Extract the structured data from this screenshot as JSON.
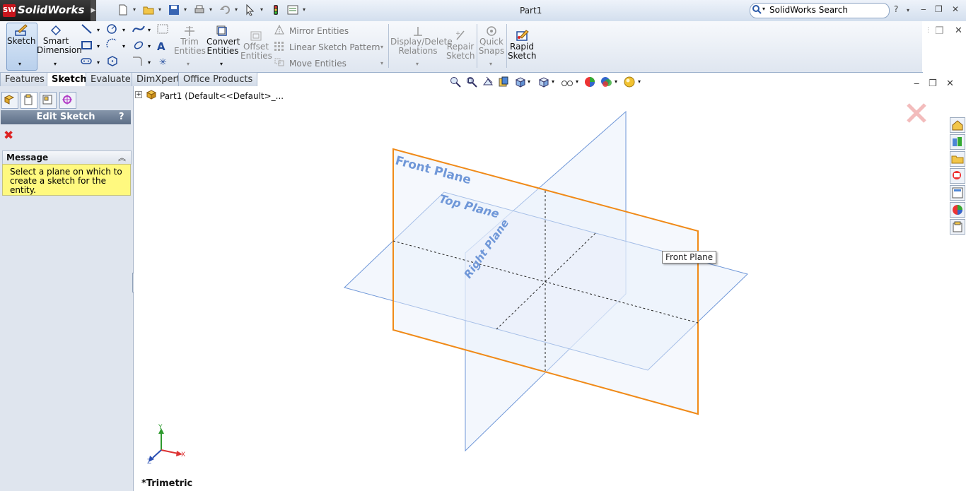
{
  "app": {
    "logo_badge": "SW",
    "logo_text": "SolidWorks",
    "document_title": "Part1",
    "search_placeholder": "SolidWorks Search",
    "help_label": "?"
  },
  "commands": {
    "sketch": "Sketch",
    "smart_dimension_1": "Smart",
    "smart_dimension_2": "Dimension",
    "trim_1": "Trim",
    "trim_2": "Entities",
    "convert_1": "Convert",
    "convert_2": "Entities",
    "offset_1": "Offset",
    "offset_2": "Entities",
    "mirror": "Mirror Entities",
    "linear_pattern": "Linear Sketch Pattern",
    "move": "Move Entities",
    "display_delete_1": "Display/Delete",
    "display_delete_2": "Relations",
    "repair_1": "Repair",
    "repair_2": "Sketch",
    "quick_1": "Quick",
    "quick_2": "Snaps",
    "rapid_1": "Rapid",
    "rapid_2": "Sketch"
  },
  "tabs": [
    {
      "label": "Features"
    },
    {
      "label": "Sketch"
    },
    {
      "label": "Evaluate"
    },
    {
      "label": "DimXpert"
    },
    {
      "label": "Office Products"
    }
  ],
  "property_manager": {
    "title": "Edit Sketch",
    "help": "?",
    "message_header": "Message",
    "message_line1": "Select a plane on which to",
    "message_line2": "create a sketch for the entity."
  },
  "feature_tree": {
    "root_label": "Part1  (Default<<Default>_..."
  },
  "viewport": {
    "front_plane_label": "Front Plane",
    "top_plane_label": "Top Plane",
    "right_plane_label": "Right Plane",
    "tooltip": "Front Plane",
    "view_name": "*Trimetric",
    "triad_x": "X",
    "triad_y": "Y",
    "triad_z": "Z"
  },
  "colors": {
    "plane_blue": "#6f97d8",
    "selected_plane_orange": "#f08a18",
    "plane_fill": "#e9f0fb",
    "message_yellow": "#fff97f"
  }
}
